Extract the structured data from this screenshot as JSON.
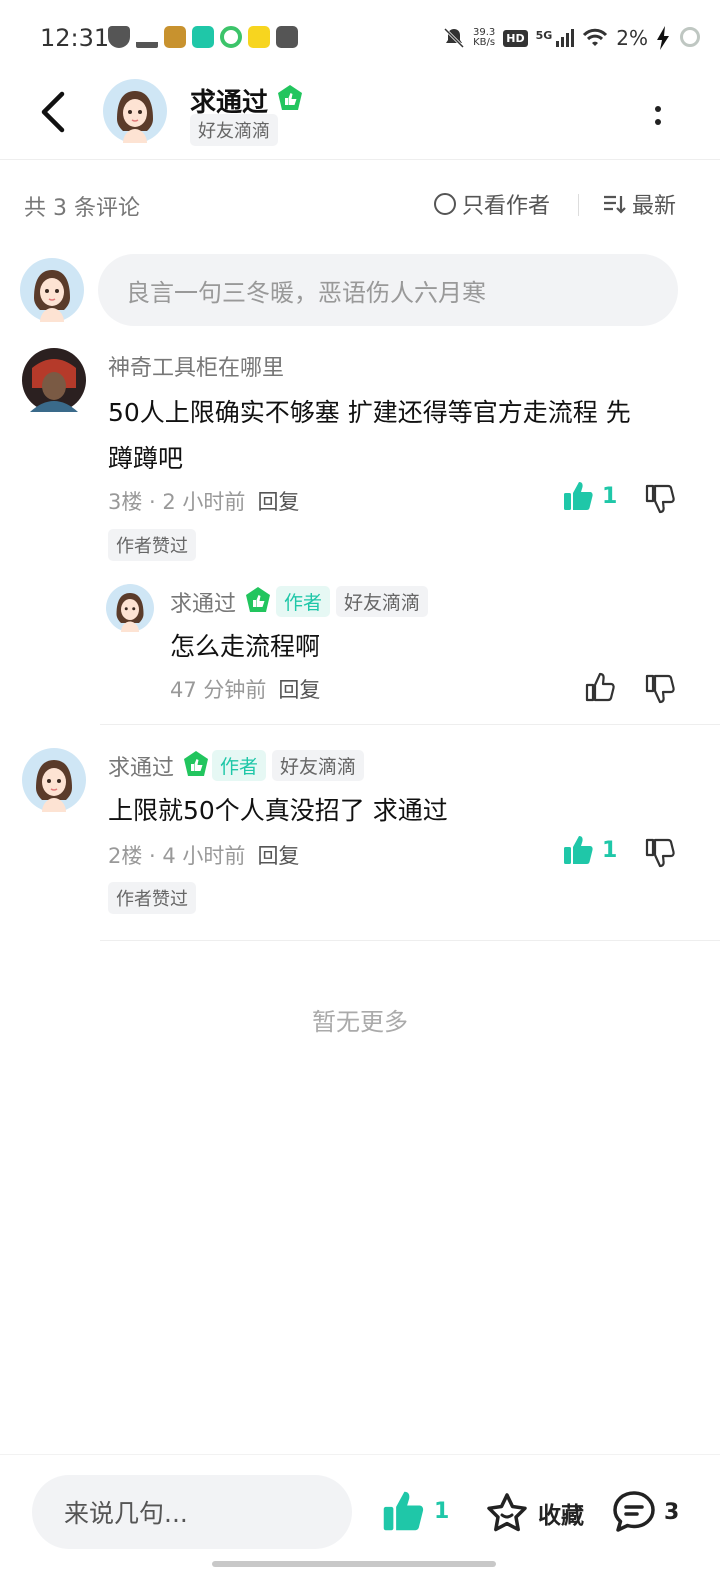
{
  "status_bar": {
    "time": "12:31",
    "net_speed_top": "39.3",
    "net_speed_bottom": "KB/s",
    "hd_label": "HD",
    "network_label": "5G",
    "battery": "2%"
  },
  "header": {
    "name": "求通过",
    "group_tag": "好友滴滴"
  },
  "comments_bar": {
    "count_text": "共 3 条评论",
    "author_only_label": "只看作者",
    "sort_label": "最新"
  },
  "comment_input": {
    "placeholder": "良言一句三冬暖，恶语伤人六月寒"
  },
  "comments": [
    {
      "user": "神奇工具柜在哪里",
      "body_line1": "50人上限确实不够塞 扩建还得等官方走流程 先",
      "body_line2": "蹲蹲吧",
      "meta": "3楼 · 2 小时前",
      "reply_label": "回复",
      "likes": "1",
      "tag": "作者赞过",
      "replies": [
        {
          "user": "求通过",
          "author_tag": "作者",
          "group_tag": "好友滴滴",
          "body": "怎么走流程啊",
          "meta": "47 分钟前",
          "reply_label": "回复"
        }
      ]
    },
    {
      "user": "求通过",
      "author_tag": "作者",
      "group_tag": "好友滴滴",
      "body_line1": "上限就50个人真没招了 求通过",
      "meta": "2楼 · 4 小时前",
      "reply_label": "回复",
      "likes": "1",
      "tag": "作者赞过"
    }
  ],
  "no_more_text": "暂无更多",
  "bottom_bar": {
    "input_placeholder": "来说几句...",
    "like_count": "1",
    "favorite_label": "收藏",
    "comment_count": "3"
  },
  "colors": {
    "accent": "#1fc7a8",
    "verified_green": "#22c55e",
    "input_bg": "#f2f3f5"
  },
  "icons": [
    "back-icon",
    "verified-icon",
    "more-icon",
    "sort-icon",
    "thumbs-up-icon",
    "thumbs-down-icon",
    "star-icon",
    "comment-icon"
  ]
}
